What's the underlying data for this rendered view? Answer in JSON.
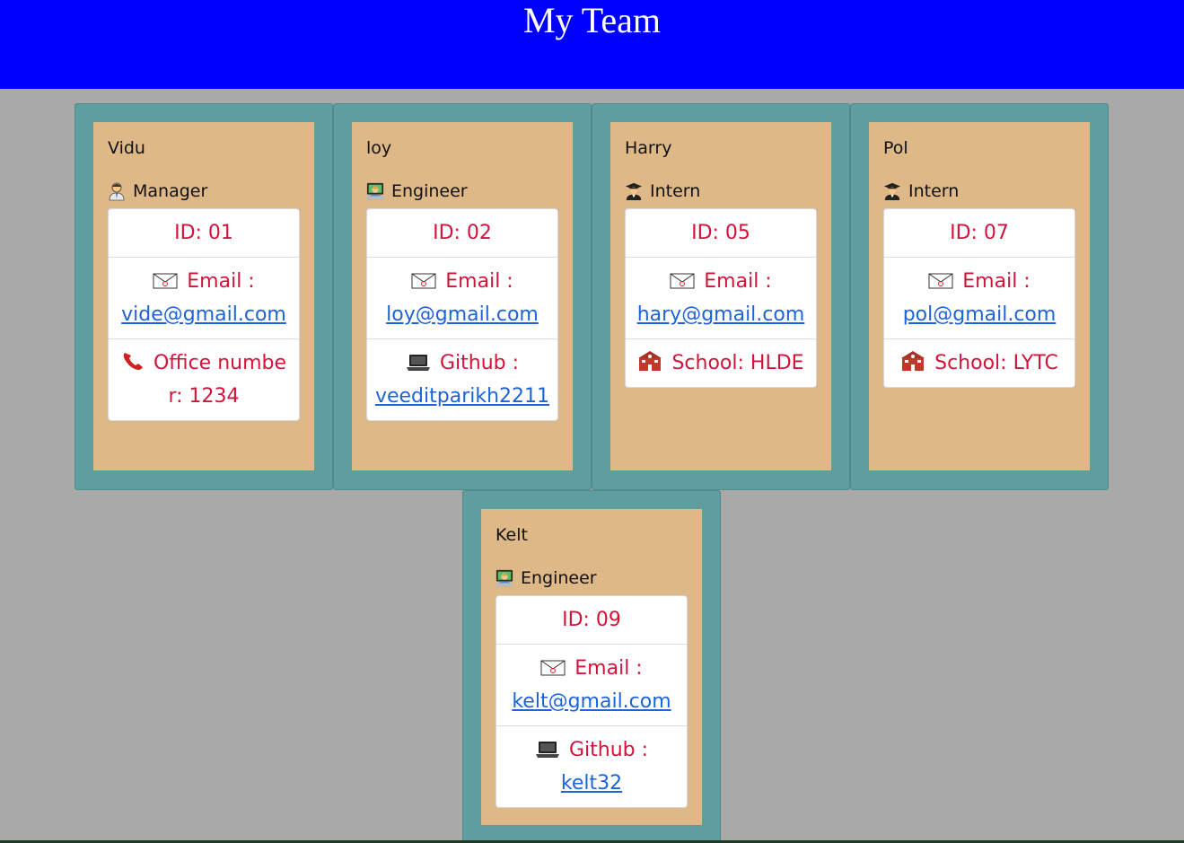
{
  "header": {
    "title": "My Team"
  },
  "cards": [
    {
      "name": "Vidu",
      "role": "Manager",
      "role_icon": "manager-icon",
      "id": "ID: 01",
      "email_label": "Email :",
      "email": "vide@gmail.com",
      "extra_label": "Office number: 1234",
      "extra_icon": "phone-icon",
      "extra_link": ""
    },
    {
      "name": "loy",
      "role": "Engineer",
      "role_icon": "engineer-icon",
      "id": "ID: 02",
      "email_label": "Email :",
      "email": "loy@gmail.com",
      "extra_label": "Github :",
      "extra_icon": "laptop-icon",
      "extra_link": "veeditparikh2211"
    },
    {
      "name": "Harry",
      "role": "Intern",
      "role_icon": "student-icon",
      "id": "ID: 05",
      "email_label": "Email :",
      "email": "hary@gmail.com",
      "extra_label": "School: HLDE",
      "extra_icon": "school-icon",
      "extra_link": ""
    },
    {
      "name": "Pol",
      "role": "Intern",
      "role_icon": "student-icon",
      "id": "ID: 07",
      "email_label": "Email :",
      "email": "pol@gmail.com",
      "extra_label": "School: LYTC",
      "extra_icon": "school-icon",
      "extra_link": ""
    },
    {
      "name": "Kelt",
      "role": "Engineer",
      "role_icon": "engineer-icon",
      "id": "ID: 09",
      "email_label": "Email :",
      "email": "kelt@gmail.com",
      "extra_label": "Github :",
      "extra_icon": "laptop-icon",
      "extra_link": "kelt32"
    }
  ],
  "colors": {
    "header_bg": "#0000ff",
    "page_bg": "#a9a9a9",
    "card_outer": "#5f9ea0",
    "card_inner": "#deb887",
    "text_red": "#d2143a",
    "link_blue": "#1d63d9"
  }
}
